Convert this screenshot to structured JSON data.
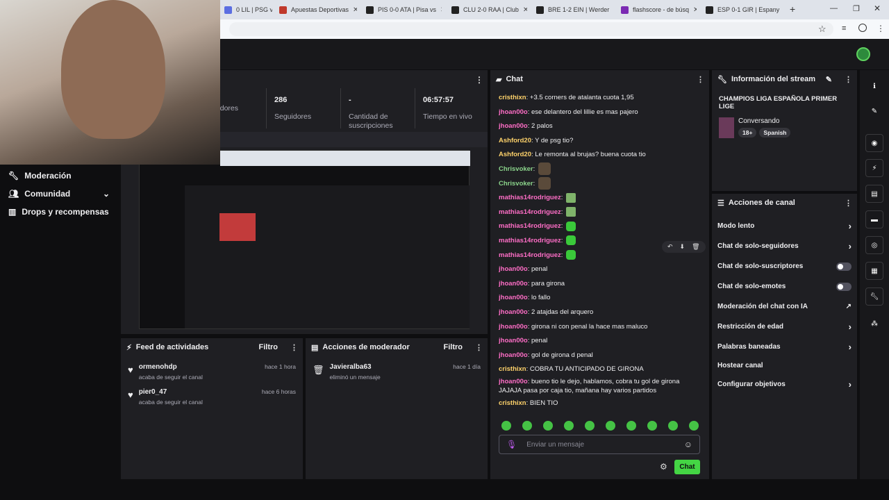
{
  "browser": {
    "tabs": [
      {
        "label": "0 LIL | PSG vs",
        "color": "#5b6ee1"
      },
      {
        "label": "Apuestas Deportivas",
        "color": "#c0392b"
      },
      {
        "label": "PIS 0-0 ATA | Pisa vs",
        "color": "#222"
      },
      {
        "label": "CLU 2-0 RAA | Club",
        "color": "#222"
      },
      {
        "label": "BRE 1-2 EIN | Werder",
        "color": "#222"
      },
      {
        "label": "flashscore - de búsq",
        "color": "#7b2ab3"
      },
      {
        "label": "ESP 0-1 GIR | Espany",
        "color": "#222"
      }
    ],
    "new_tab": "+"
  },
  "stats": [
    {
      "num": "",
      "label": "tadores"
    },
    {
      "num": "286",
      "label": "Seguidores"
    },
    {
      "num": "-",
      "label": "Cantidad de suscripciones"
    },
    {
      "num": "06:57:57",
      "label": "Tiempo en vivo"
    }
  ],
  "nav": [
    {
      "label": "Moderación",
      "icon": "wrench-icon"
    },
    {
      "label": "Comunidad",
      "icon": "people-icon"
    },
    {
      "label": "Drops y recompensas",
      "icon": "chart-icon"
    }
  ],
  "chat": {
    "title": "Chat",
    "messages": [
      {
        "user": "cristhixn",
        "cls": "u-yellow",
        "text": "+3.5 corners de atalanta cuota 1,95"
      },
      {
        "user": "jhoan00o",
        "cls": "u-pink",
        "text": "ese delantero del lillie es mas pajero"
      },
      {
        "user": "jhoan00o",
        "cls": "u-pink",
        "text": "2 palos"
      },
      {
        "user": "Ashford20",
        "cls": "u-yellow",
        "text": "Y de psg tio?"
      },
      {
        "user": "Ashford20",
        "cls": "u-yellow",
        "text": "Le remonta al brujas? buena cuota tio"
      },
      {
        "user": "Chrisvoker",
        "cls": "u-green",
        "text": "",
        "emote": "img"
      },
      {
        "user": "Chrisvoker",
        "cls": "u-green",
        "text": "",
        "emote": "img"
      },
      {
        "user": "mathias14rodriguez",
        "cls": "u-pink",
        "text": "",
        "emote": "box"
      },
      {
        "user": "mathias14rodriguez",
        "cls": "u-pink",
        "text": "",
        "emote": "box"
      },
      {
        "user": "mathias14rodriguez",
        "cls": "u-pink",
        "text": "",
        "emote": "green"
      },
      {
        "user": "mathias14rodriguez",
        "cls": "u-pink",
        "text": "",
        "emote": "green"
      },
      {
        "user": "mathias14rodriguez",
        "cls": "u-pink",
        "text": "",
        "emote": "green"
      },
      {
        "user": "jhoan00o",
        "cls": "u-pink",
        "text": "penal"
      },
      {
        "user": "jhoan00o",
        "cls": "u-pink",
        "text": "para girona"
      },
      {
        "user": "jhoan00o",
        "cls": "u-pink",
        "text": "lo fallo"
      },
      {
        "user": "jhoan00o",
        "cls": "u-pink",
        "text": "2 atajdas del arquero"
      },
      {
        "user": "jhoan00o",
        "cls": "u-pink",
        "text": "girona ni con penal la hace mas maluco"
      },
      {
        "user": "jhoan00o",
        "cls": "u-pink",
        "text": "penal"
      },
      {
        "user": "jhoan00o",
        "cls": "u-pink",
        "text": "gol de girona d penal"
      },
      {
        "user": "cristhixn",
        "cls": "u-yellow",
        "text": "COBRA TU ANTICIPADO DE GIRONA"
      },
      {
        "user": "jhoan00o",
        "cls": "u-pink",
        "text": "bueno tio le dejo, hablamos, cobra tu gol de girona JAJAJA pasa por caja tio, mañana hay varios partidos"
      },
      {
        "user": "cristhixn",
        "cls": "u-yellow",
        "text": "BIEN TIO"
      }
    ],
    "input_placeholder": "Enviar un mensaje",
    "send_label": "Chat"
  },
  "stream_info": {
    "title": "Información del stream",
    "stream_title": "CHAMPIOS LIGA ESPAÑOLA PRIMER LIGE",
    "category": "Conversando",
    "tags": [
      "18+",
      "Spanish"
    ]
  },
  "channel_actions": {
    "title": "Acciones de canal",
    "items": [
      {
        "label": "Modo lento",
        "kind": "chev"
      },
      {
        "label": "Chat de solo-seguidores",
        "kind": "chev"
      },
      {
        "label": "Chat de solo-suscriptores",
        "kind": "toggle"
      },
      {
        "label": "Chat de solo-emotes",
        "kind": "toggle"
      },
      {
        "label": "Moderación del chat con IA",
        "kind": "ext"
      },
      {
        "label": "Restricción de edad",
        "kind": "chev"
      },
      {
        "label": "Palabras baneadas",
        "kind": "chev"
      },
      {
        "label": "Hostear canal",
        "kind": "none"
      },
      {
        "label": "Configurar objetivos",
        "kind": "chev"
      }
    ]
  },
  "feed": {
    "title": "Feed de actividades",
    "filter": "Filtro",
    "items": [
      {
        "name": "ormenohdp",
        "sub": "acaba de seguir el canal",
        "time": "hace 1 hora"
      },
      {
        "name": "pier0_47",
        "sub": "acaba de seguir el canal",
        "time": "hace 6 horas"
      }
    ]
  },
  "mod_actions": {
    "title": "Acciones de moderador",
    "filter": "Filtro",
    "items": [
      {
        "name": "Javieralba63",
        "sub": "eliminó un mensaje",
        "time": "hace 1 día"
      }
    ]
  }
}
